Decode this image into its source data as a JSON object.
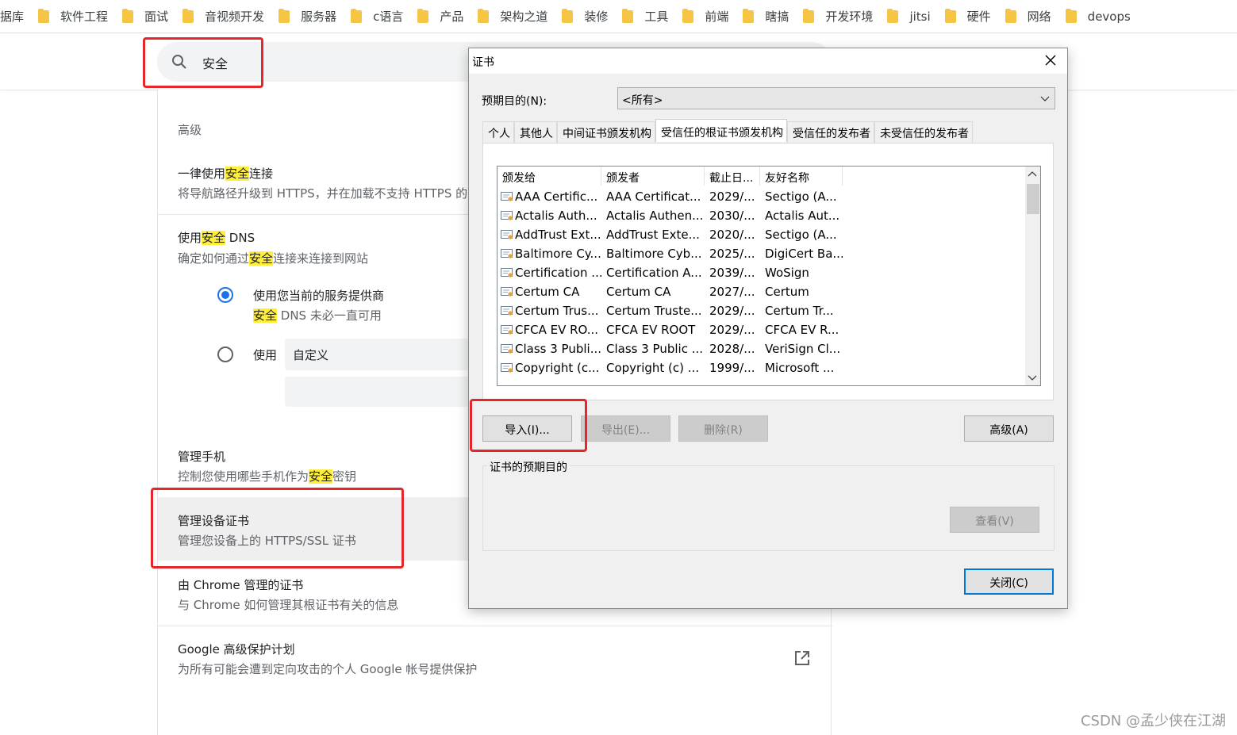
{
  "bookmarks": [
    "据库",
    "软件工程",
    "面试",
    "音视频开发",
    "服务器",
    "c语言",
    "产品",
    "架构之道",
    "装修",
    "工具",
    "前端",
    "瞎搞",
    "开发环境",
    "jitsi",
    "硬件",
    "网络",
    "devops"
  ],
  "search": {
    "query": "安全"
  },
  "settings": {
    "section_title": "高级",
    "https_title_pre": "一律使用",
    "https_title_hl": "安全",
    "https_title_post": "连接",
    "https_sub": "将导航路径升级到 HTTPS，并在加载不支持 HTTPS 的网站前提醒您",
    "dns_title_pre": "使用",
    "dns_title_hl": "安全",
    "dns_title_post": " DNS",
    "dns_sub_pre": "确定如何通过",
    "dns_sub_hl": "安全",
    "dns_sub_post": "连接来连接到网站",
    "dns_option1": "使用您当前的服务提供商",
    "dns_option1_sub_hl": "安全",
    "dns_option1_sub_post": " DNS 未必一直可用",
    "dns_option2": "使用",
    "dns_provider_selected": "自定义",
    "phone_title": "管理手机",
    "phone_sub_pre": "控制您使用哪些手机作为",
    "phone_sub_hl": "安全",
    "phone_sub_post": "密钥",
    "certs_title": "管理设备证书",
    "certs_sub": "管理您设备上的 HTTPS/SSL 证书",
    "chrome_certs_title": "由 Chrome 管理的证书",
    "chrome_certs_sub": "与 Chrome 如何管理其根证书有关的信息",
    "gapp_title": "Google 高级保护计划",
    "gapp_sub": "为所有可能会遭到定向攻击的个人 Google 帐号提供保护"
  },
  "dialog": {
    "title": "证书",
    "purpose_label": "预期目的(N):",
    "purpose_value": "<所有>",
    "tabs": [
      "个人",
      "其他人",
      "中间证书颁发机构",
      "受信任的根证书颁发机构",
      "受信任的发布者",
      "未受信任的发布者"
    ],
    "active_tab": 3,
    "columns": [
      "颁发给",
      "颁发者",
      "截止日...",
      "友好名称"
    ],
    "rows": [
      [
        "AAA Certific...",
        "AAA Certificat...",
        "2029/...",
        "Sectigo (A..."
      ],
      [
        "Actalis Auth...",
        "Actalis Authen...",
        "2030/...",
        "Actalis Aut..."
      ],
      [
        "AddTrust Ext...",
        "AddTrust Exte...",
        "2020/...",
        "Sectigo (A..."
      ],
      [
        "Baltimore Cy...",
        "Baltimore Cyb...",
        "2025/...",
        "DigiCert Ba..."
      ],
      [
        "Certification ...",
        "Certification A...",
        "2039/...",
        "WoSign"
      ],
      [
        "Certum CA",
        "Certum CA",
        "2027/...",
        "Certum"
      ],
      [
        "Certum Trus...",
        "Certum Truste...",
        "2029/...",
        "Certum Tr..."
      ],
      [
        "CFCA EV RO...",
        "CFCA EV ROOT",
        "2029/...",
        "CFCA EV R..."
      ],
      [
        "Class 3 Publi...",
        "Class 3 Public ...",
        "2028/...",
        "VeriSign Cl..."
      ],
      [
        "Copyright (c...",
        "Copyright (c) ...",
        "1999/...",
        "Microsoft ..."
      ]
    ],
    "import_btn": "导入(I)...",
    "export_btn": "导出(E)...",
    "remove_btn": "删除(R)",
    "advanced_btn": "高级(A)",
    "purposes_group": "证书的预期目的",
    "view_btn": "查看(V)",
    "close_btn": "关闭(C)"
  },
  "watermark": "CSDN @孟少侠在江湖",
  "colors": {
    "highlight": "#ffef3a",
    "annotation_red": "#e5262b",
    "radio_blue": "#1a73e8"
  }
}
